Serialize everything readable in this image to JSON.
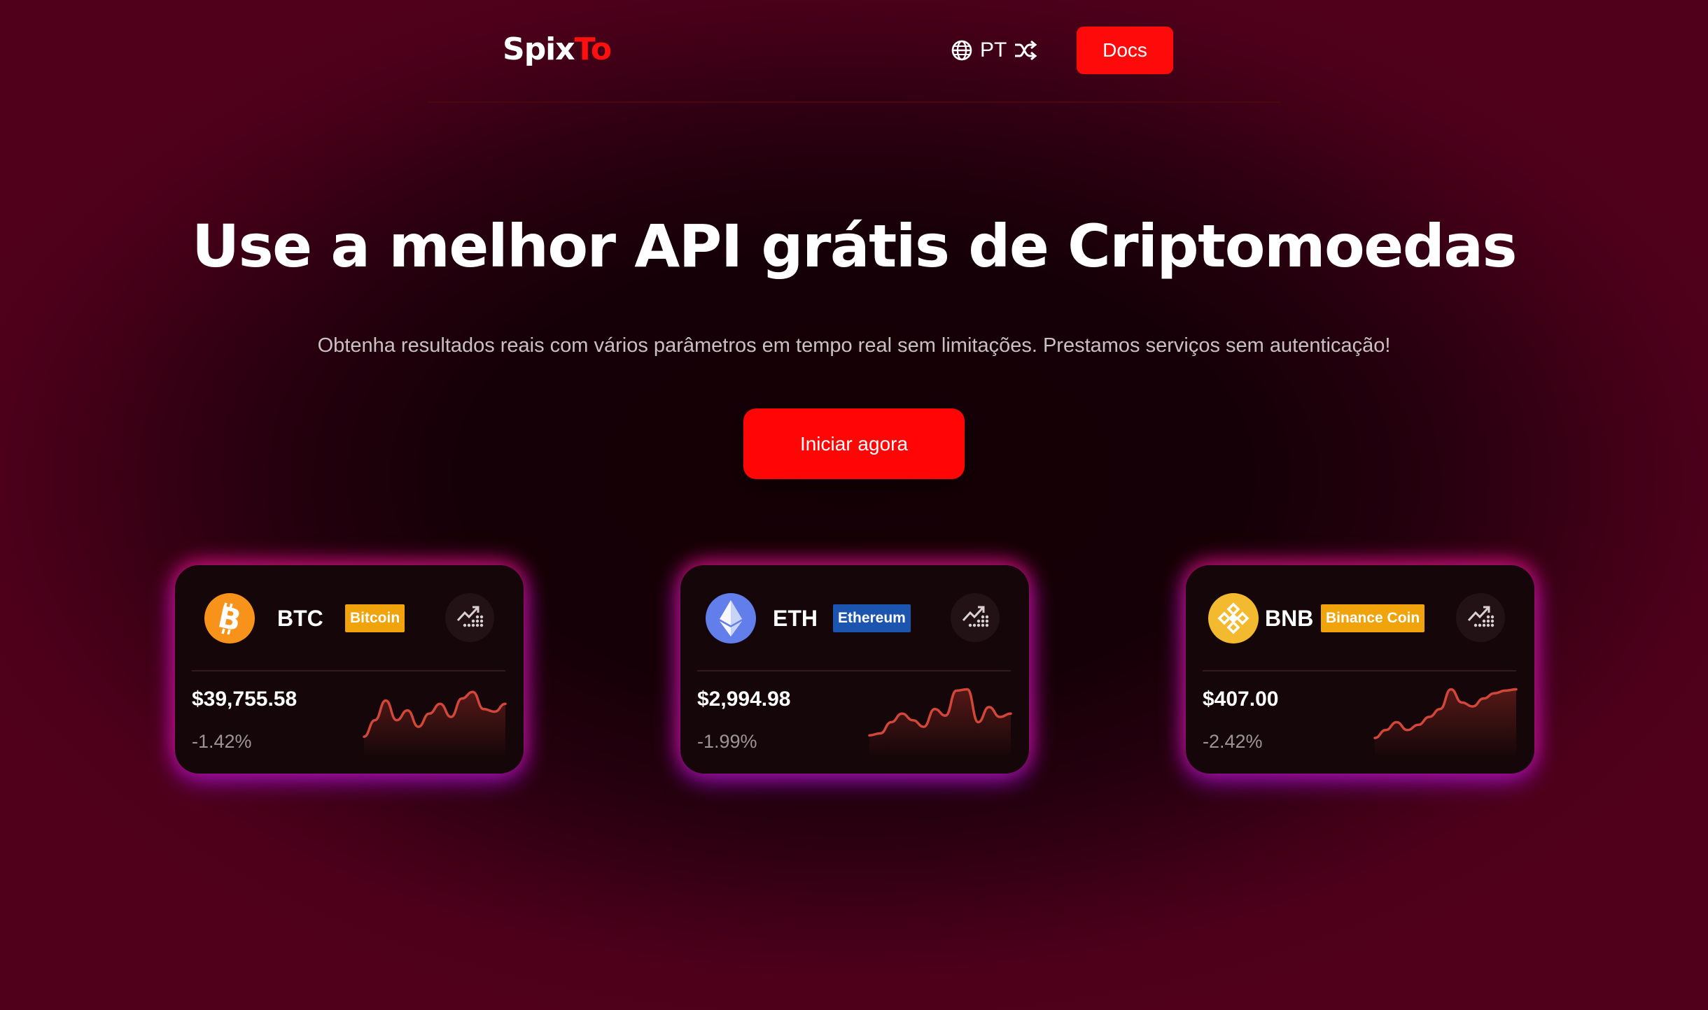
{
  "header": {
    "logo_part1": "Spix",
    "logo_part2": "To",
    "language": "PT",
    "docs_label": "Docs"
  },
  "hero": {
    "title": "Use a melhor API grátis de Criptomoedas",
    "subtitle": "Obtenha resultados reais com vários parâmetros em tempo real sem limitações. Prestamos serviços sem autenticação!",
    "cta_label": "Iniciar agora"
  },
  "cards": [
    {
      "symbol": "BTC",
      "name": "Bitcoin",
      "price": "$39,755.58",
      "change": "-1.42%",
      "badge_color": "#f0a30a",
      "icon_color": "#f7931a",
      "icon": "bitcoin-icon",
      "trend": [
        0.2,
        0.45,
        0.75,
        0.45,
        0.6,
        0.35,
        0.55,
        0.7,
        0.5,
        0.78,
        0.88,
        0.62,
        0.58,
        0.7
      ]
    },
    {
      "symbol": "ETH",
      "name": "Ethereum",
      "price": "$2,994.98",
      "change": "-1.99%",
      "badge_color": "#1c55b0",
      "icon_color": "#627eea",
      "icon": "ethereum-icon",
      "trend": [
        0.22,
        0.25,
        0.42,
        0.55,
        0.45,
        0.35,
        0.62,
        0.52,
        0.9,
        0.92,
        0.42,
        0.65,
        0.5,
        0.55
      ]
    },
    {
      "symbol": "BNB",
      "name": "Binance Coin",
      "price": "$407.00",
      "change": "-2.42%",
      "badge_color": "#f0a30a",
      "icon_color": "#f3ba2f",
      "icon": "binance-coin-icon",
      "trend": [
        0.18,
        0.3,
        0.42,
        0.3,
        0.38,
        0.5,
        0.62,
        0.92,
        0.72,
        0.66,
        0.78,
        0.86,
        0.9,
        0.92
      ]
    }
  ]
}
